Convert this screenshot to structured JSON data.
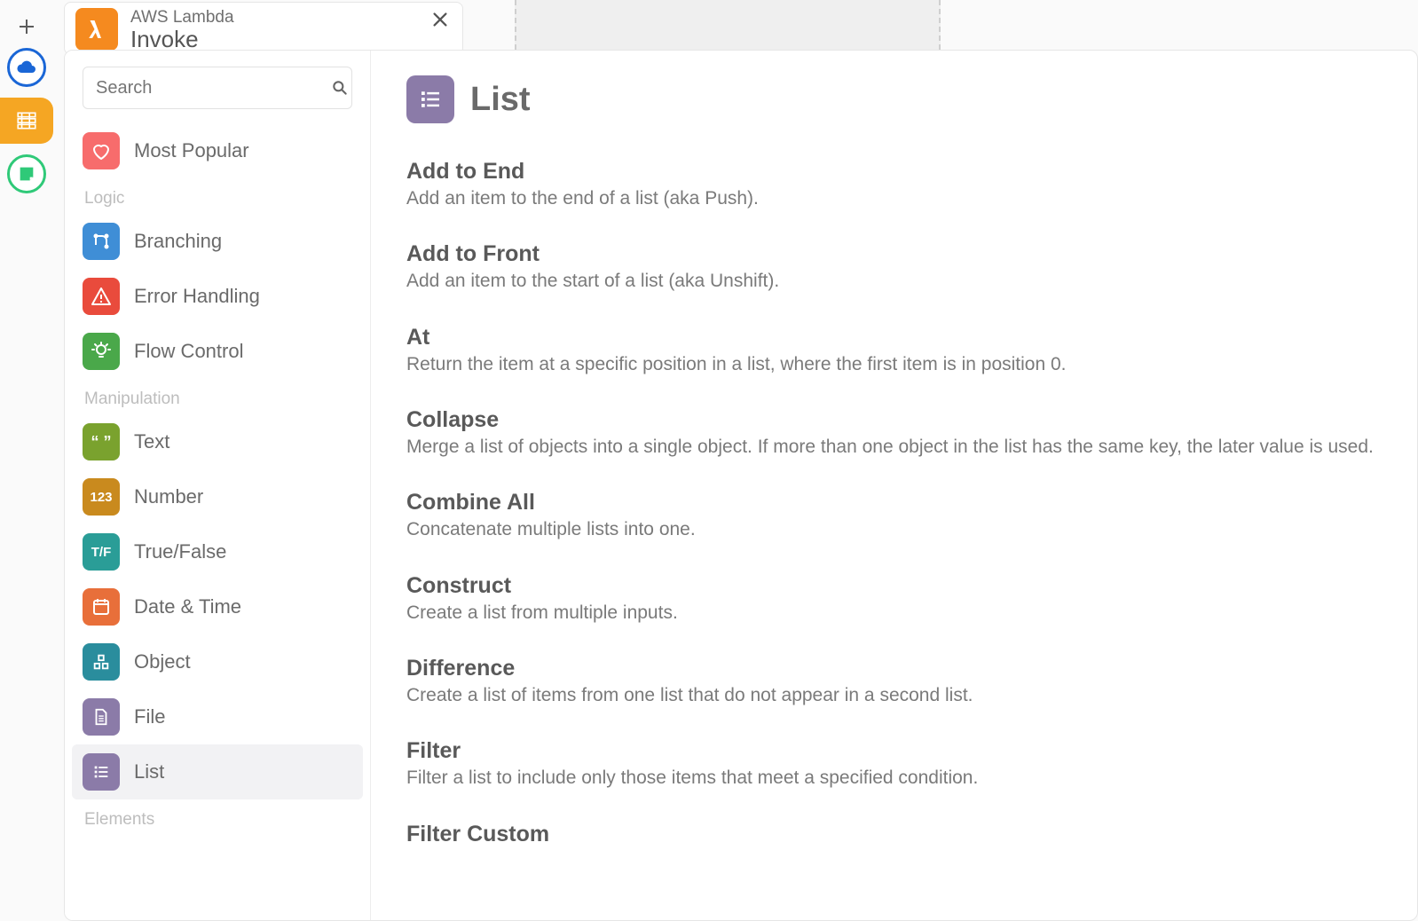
{
  "tab": {
    "title": "AWS Lambda",
    "subtitle": "Invoke"
  },
  "search": {
    "placeholder": "Search"
  },
  "sidebar": {
    "topItem": {
      "label": "Most Popular",
      "color": "#f76c6c"
    },
    "sections": [
      {
        "header": "Logic",
        "items": [
          {
            "label": "Branching",
            "color": "#3f8ed6",
            "icon": "branch"
          },
          {
            "label": "Error Handling",
            "color": "#e94b3c",
            "icon": "warning"
          },
          {
            "label": "Flow Control",
            "color": "#4aa84a",
            "icon": "bulb"
          }
        ]
      },
      {
        "header": "Manipulation",
        "items": [
          {
            "label": "Text",
            "color": "#7aa22e",
            "icon": "quotes"
          },
          {
            "label": "Number",
            "color": "#c98a1e",
            "icon": "123"
          },
          {
            "label": "True/False",
            "color": "#2a9d97",
            "icon": "tf"
          },
          {
            "label": "Date & Time",
            "color": "#e86f3a",
            "icon": "calendar"
          },
          {
            "label": "Object",
            "color": "#2a8d9d",
            "icon": "shapes"
          },
          {
            "label": "File",
            "color": "#8b7ba8",
            "icon": "file"
          },
          {
            "label": "List",
            "color": "#8b7ba8",
            "icon": "list",
            "active": true
          }
        ]
      },
      {
        "header": "Elements",
        "items": []
      }
    ]
  },
  "content": {
    "title": "List",
    "functions": [
      {
        "name": "Add to End",
        "desc": "Add an item to the end of a list (aka Push)."
      },
      {
        "name": "Add to Front",
        "desc": "Add an item to the start of a list (aka Unshift)."
      },
      {
        "name": "At",
        "desc": "Return the item at a specific position in a list, where the first item is in position 0."
      },
      {
        "name": "Collapse",
        "desc": "Merge a list of objects into a single object. If more than one object in the list has the same key, the later value is used."
      },
      {
        "name": "Combine All",
        "desc": "Concatenate multiple lists into one."
      },
      {
        "name": "Construct",
        "desc": "Create a list from multiple inputs."
      },
      {
        "name": "Difference",
        "desc": "Create a list of items from one list that do not appear in a second list."
      },
      {
        "name": "Filter",
        "desc": "Filter a list to include only those items that meet a specified condition."
      },
      {
        "name": "Filter Custom",
        "desc": ""
      }
    ]
  }
}
